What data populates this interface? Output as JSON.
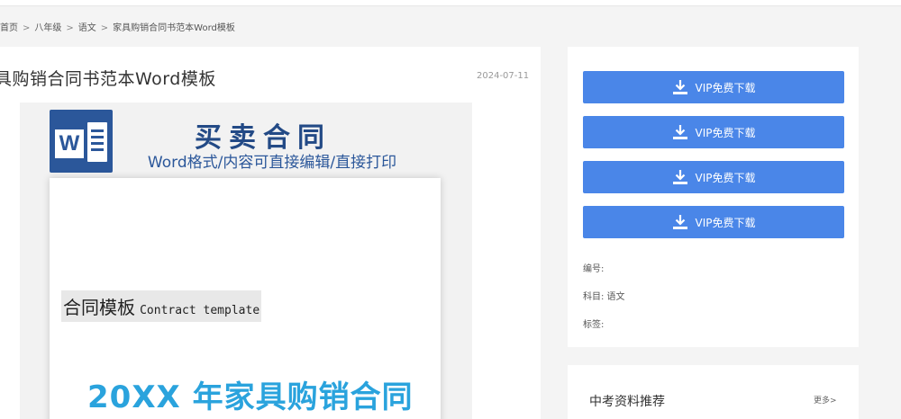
{
  "breadcrumb": {
    "home": "首页",
    "grade": "八年级",
    "subject": "语文",
    "current": "家具购销合同书范本Word模板",
    "sep": ">"
  },
  "article": {
    "title": "具购销合同书范本Word模板",
    "date": "2024-07-11"
  },
  "preview": {
    "logo_letter": "W",
    "heading": "买卖合同",
    "subheading": "Word格式/内容可直接编辑/直接打印",
    "tag_zh": "合同模板",
    "tag_en": "Contract template",
    "big_title": "20XX 年家具购销合同"
  },
  "download": {
    "button_label": "VIP免费下载",
    "accent": "#4a86e8"
  },
  "meta": {
    "number_label": "编号:",
    "subject_label": "科目: 语文",
    "tags_label": "标签:"
  },
  "recommend": {
    "title": "中考资料推荐",
    "more": "更多>"
  }
}
